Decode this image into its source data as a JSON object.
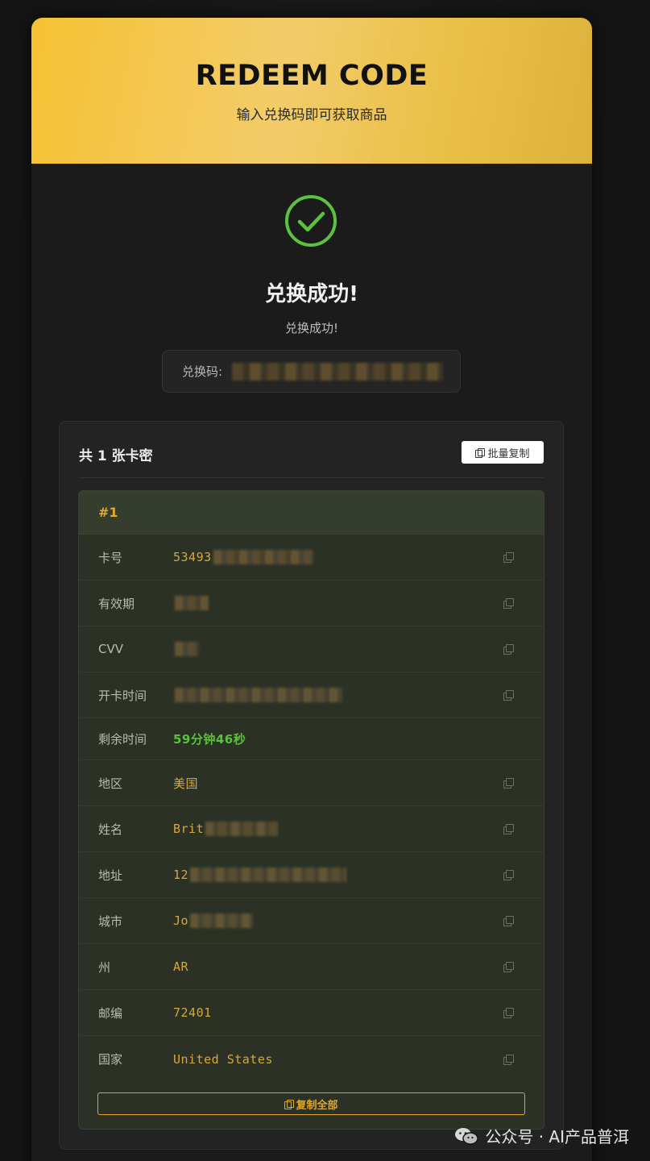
{
  "header": {
    "title": "REDEEM CODE",
    "subtitle": "输入兑换码即可获取商品"
  },
  "result": {
    "icon": "check-circle-icon",
    "title": "兑换成功!",
    "message": "兑换成功!",
    "code_label": "兑换码:"
  },
  "panel": {
    "title": "共 1 张卡密",
    "batch_copy_label": "批量复制",
    "copy_all_label": "复制全部"
  },
  "item": {
    "index": "#1",
    "rows": [
      {
        "label": "卡号",
        "value": "53493"
      },
      {
        "label": "有效期",
        "value": ""
      },
      {
        "label": "CVV",
        "value": ""
      },
      {
        "label": "开卡时间",
        "value": ""
      },
      {
        "label": "剩余时间",
        "value": "59分钟46秒"
      },
      {
        "label": "地区",
        "value": "美国"
      },
      {
        "label": "姓名",
        "value": "Brit"
      },
      {
        "label": "地址",
        "value": "12"
      },
      {
        "label": "城市",
        "value": "Jo"
      },
      {
        "label": "州",
        "value": "AR"
      },
      {
        "label": "邮编",
        "value": "72401"
      },
      {
        "label": "国家",
        "value": "United States"
      }
    ]
  },
  "watermark": {
    "text": "公众号 · AI产品普洱",
    "icon": "wechat-icon"
  },
  "colors": {
    "accent": "#e0a72c",
    "success": "#5cc13c",
    "header_gold": "#f3c94d"
  }
}
